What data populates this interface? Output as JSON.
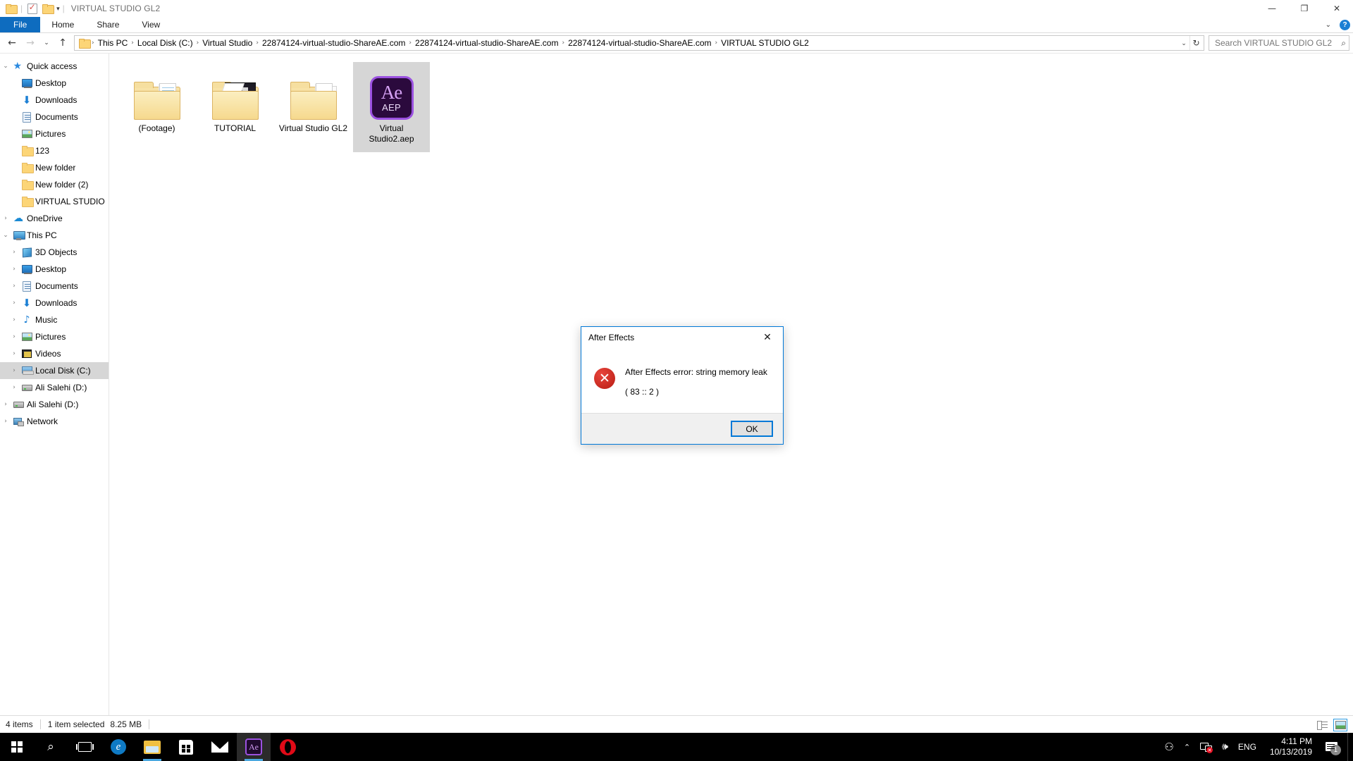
{
  "window": {
    "title": "VIRTUAL STUDIO GL2",
    "quick_access_toolbar": [
      {
        "name": "folder-icon",
        "label": ""
      },
      {
        "name": "properties-icon",
        "label": ""
      },
      {
        "name": "new-folder-icon",
        "label": ""
      },
      {
        "name": "customize-chevron-icon",
        "label": "▾"
      }
    ],
    "controls": {
      "minimize": "—",
      "maximize": "❐",
      "close": "✕",
      "ribbon_collapse": "⌄",
      "help": "?"
    }
  },
  "ribbon": {
    "tabs": [
      {
        "label": "File",
        "active": true
      },
      {
        "label": "Home",
        "active": false
      },
      {
        "label": "Share",
        "active": false
      },
      {
        "label": "View",
        "active": false
      }
    ]
  },
  "addressbar": {
    "back": "←",
    "forward": "→",
    "recent": "⌄",
    "up": "↑",
    "dropdown": "⌄",
    "refresh": "↻",
    "breadcrumbs": [
      "This PC",
      "Local Disk (C:)",
      "Virtual Studio",
      "22874124-virtual-studio-ShareAE.com",
      "22874124-virtual-studio-ShareAE.com",
      "22874124-virtual-studio-ShareAE.com",
      "VIRTUAL STUDIO GL2"
    ],
    "separator": "›"
  },
  "search": {
    "placeholder": "Search VIRTUAL STUDIO GL2",
    "value": "",
    "icon": "⌕"
  },
  "navigation_pane": {
    "items": [
      {
        "label": "Quick access",
        "icon": "star-icon",
        "expander": "⌄",
        "indent": 0,
        "selected": false
      },
      {
        "label": "Desktop",
        "icon": "desktop-icon",
        "expander": "",
        "indent": 1,
        "selected": false,
        "pinned": true
      },
      {
        "label": "Downloads",
        "icon": "downloads-icon",
        "expander": "",
        "indent": 1,
        "selected": false,
        "pinned": true
      },
      {
        "label": "Documents",
        "icon": "documents-icon",
        "expander": "",
        "indent": 1,
        "selected": false,
        "pinned": true
      },
      {
        "label": "Pictures",
        "icon": "pictures-icon",
        "expander": "",
        "indent": 1,
        "selected": false,
        "pinned": true
      },
      {
        "label": "123",
        "icon": "folder-icon",
        "expander": "",
        "indent": 1,
        "selected": false
      },
      {
        "label": "New folder",
        "icon": "folder-icon",
        "expander": "",
        "indent": 1,
        "selected": false
      },
      {
        "label": "New folder (2)",
        "icon": "folder-icon",
        "expander": "",
        "indent": 1,
        "selected": false
      },
      {
        "label": "VIRTUAL STUDIO Gl",
        "icon": "folder-icon",
        "expander": "",
        "indent": 1,
        "selected": false
      },
      {
        "label": "OneDrive",
        "icon": "onedrive-icon",
        "expander": "›",
        "indent": 0,
        "selected": false
      },
      {
        "label": "This PC",
        "icon": "this-pc-icon",
        "expander": "⌄",
        "indent": 0,
        "selected": false
      },
      {
        "label": "3D Objects",
        "icon": "3d-objects-icon",
        "expander": "›",
        "indent": 1,
        "selected": false
      },
      {
        "label": "Desktop",
        "icon": "desktop-icon",
        "expander": "›",
        "indent": 1,
        "selected": false
      },
      {
        "label": "Documents",
        "icon": "documents-icon",
        "expander": "›",
        "indent": 1,
        "selected": false
      },
      {
        "label": "Downloads",
        "icon": "downloads-icon",
        "expander": "›",
        "indent": 1,
        "selected": false
      },
      {
        "label": "Music",
        "icon": "music-icon",
        "expander": "›",
        "indent": 1,
        "selected": false
      },
      {
        "label": "Pictures",
        "icon": "pictures-icon",
        "expander": "›",
        "indent": 1,
        "selected": false
      },
      {
        "label": "Videos",
        "icon": "videos-icon",
        "expander": "›",
        "indent": 1,
        "selected": false
      },
      {
        "label": "Local Disk (C:)",
        "icon": "local-disk-icon",
        "expander": "›",
        "indent": 1,
        "selected": true
      },
      {
        "label": "Ali Salehi (D:)",
        "icon": "drive-icon",
        "expander": "›",
        "indent": 1,
        "selected": false
      },
      {
        "label": "Ali Salehi (D:)",
        "icon": "drive-icon",
        "expander": "›",
        "indent": 0,
        "selected": false
      },
      {
        "label": "Network",
        "icon": "network-icon",
        "expander": "›",
        "indent": 0,
        "selected": false
      }
    ]
  },
  "files": [
    {
      "name": "(Footage)",
      "type": "folder-lines",
      "selected": false
    },
    {
      "name": "TUTORIAL",
      "type": "folder-media",
      "selected": false
    },
    {
      "name": "Virtual Studio GL2",
      "type": "folder-docs",
      "selected": false
    },
    {
      "name": "Virtual Studio2.aep",
      "type": "aep-file",
      "selected": true,
      "badge": "AEP",
      "app": "Ae"
    }
  ],
  "statusbar": {
    "item_count": "4 items",
    "selection": "1 item selected",
    "size": "8.25 MB",
    "views": [
      {
        "name": "details-view-button",
        "active": false
      },
      {
        "name": "thumbnails-view-button",
        "active": true
      }
    ]
  },
  "dialog": {
    "title": "After Effects",
    "close": "✕",
    "error_icon": "✕",
    "message_line1": "After Effects error: string memory leak",
    "message_line2": "( 83 :: 2 )",
    "ok_label": "OK"
  },
  "taskbar": {
    "start": "start-button",
    "items": [
      {
        "name": "search-taskbar-button",
        "icon": "⌕",
        "running": false,
        "active": false
      },
      {
        "name": "task-view-button",
        "icon": "taskview",
        "running": false,
        "active": false
      },
      {
        "name": "edge-button",
        "icon": "e",
        "running": false,
        "active": false
      },
      {
        "name": "file-explorer-button",
        "icon": "explorer",
        "running": true,
        "active": false
      },
      {
        "name": "microsoft-store-button",
        "icon": "store",
        "running": false,
        "active": false
      },
      {
        "name": "mail-button",
        "icon": "mail",
        "running": false,
        "active": false
      },
      {
        "name": "after-effects-button",
        "icon": "Ae",
        "running": true,
        "active": true
      },
      {
        "name": "opera-button",
        "icon": "opera",
        "running": false,
        "active": false
      }
    ],
    "tray": {
      "people": "⚇",
      "chevron_up": "⌃",
      "network": "network-error-icon",
      "network_badge": "✕",
      "volume": "🔊",
      "language": "ENG",
      "time": "4:11 PM",
      "date": "10/13/2019",
      "notification_count": "1"
    }
  },
  "colors": {
    "accent": "#0078d7",
    "file_tab": "#0e6cbf",
    "error_red": "#c4241a",
    "aep_purple": "#9b51e0",
    "aep_bg": "#2b0a3d",
    "selection_gray": "#d6d6d6",
    "taskbar_bg": "#000000"
  }
}
